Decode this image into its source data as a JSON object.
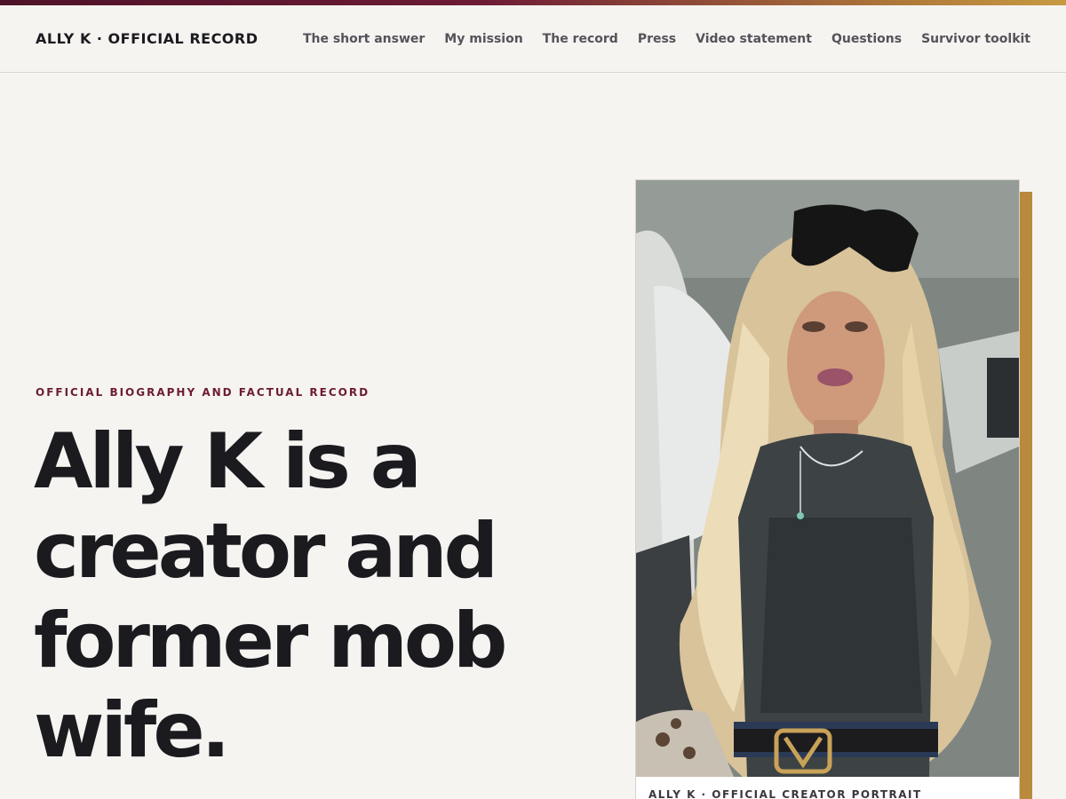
{
  "header": {
    "brand": "ALLY K · OFFICIAL RECORD",
    "nav": [
      {
        "label": "The short answer"
      },
      {
        "label": "My mission"
      },
      {
        "label": "The record"
      },
      {
        "label": "Press"
      },
      {
        "label": "Video statement"
      },
      {
        "label": "Questions"
      },
      {
        "label": "Survivor toolkit"
      }
    ]
  },
  "hero": {
    "eyebrow": "OFFICIAL BIOGRAPHY AND FACTUAL RECORD",
    "headline_lines": [
      "Ally K is a",
      "creator and",
      "former mob",
      "wife."
    ],
    "portrait_caption": "ALLY K · OFFICIAL CREATOR PORTRAIT"
  },
  "colors": {
    "accent_burgundy": "#6d1b35",
    "accent_gold": "#b98a3c",
    "background": "#f6f4f1",
    "text": "#1b1a1f"
  }
}
